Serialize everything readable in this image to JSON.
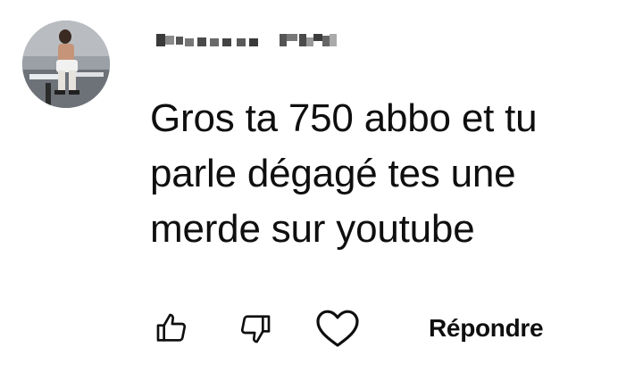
{
  "comment": {
    "text": "Gros ta 750 abbo et tu\nparle dégagé tes une\nmerde sur youtube",
    "avatar_icon": "user-avatar-photo",
    "author_icon": "pixelated-username"
  },
  "actions": {
    "like_icon": "thumb-up-icon",
    "dislike_icon": "thumb-down-icon",
    "heart_icon": "heart-icon",
    "reply_label": "Répondre"
  },
  "colors": {
    "text": "#0f0f0f",
    "background": "#ffffff"
  }
}
